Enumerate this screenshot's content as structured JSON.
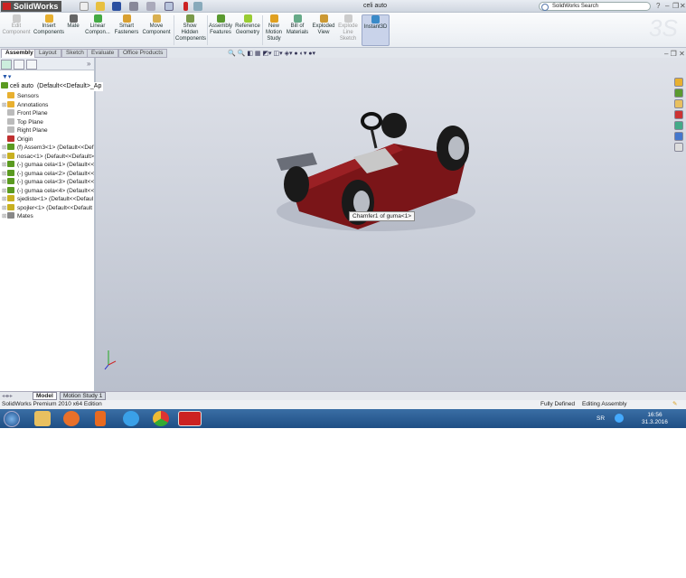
{
  "app": {
    "logo": "SolidWorks",
    "doc_title": "celi auto",
    "search_placeholder": "SolidWorks Search",
    "help": "?",
    "win_min": "–",
    "win_restore": "❐",
    "win_close": "✕"
  },
  "ribbon": [
    {
      "label": "Edit Component",
      "disabled": true
    },
    {
      "label": "Insert Components"
    },
    {
      "label": "Mate"
    },
    {
      "label": "Linear Compon..."
    },
    {
      "label": "Smart Fasteners"
    },
    {
      "label": "Move Component"
    },
    {
      "label": "Show Hidden Components"
    },
    {
      "label": "Assembly Features"
    },
    {
      "label": "Reference Geometry"
    },
    {
      "label": "New Motion Study"
    },
    {
      "label": "Bill of Materials"
    },
    {
      "label": "Exploded View"
    },
    {
      "label": "Explode Line Sketch",
      "disabled": true
    },
    {
      "label": "Instant3D",
      "active": true
    }
  ],
  "tabs": [
    "Assembly",
    "Layout",
    "Sketch",
    "Evaluate",
    "Office Products"
  ],
  "tree": {
    "root": "celi auto  (Default<<Default>_Ap",
    "items": [
      {
        "label": "Sensors",
        "exp": false,
        "color": "#e8b030"
      },
      {
        "label": "Annotations",
        "exp": true,
        "color": "#e8b030"
      },
      {
        "label": "Front Plane",
        "exp": false,
        "color": "#bbbbbb"
      },
      {
        "label": "Top Plane",
        "exp": false,
        "color": "#bbbbbb"
      },
      {
        "label": "Right Plane",
        "exp": false,
        "color": "#bbbbbb"
      },
      {
        "label": "Origin",
        "exp": false,
        "color": "#c03030"
      },
      {
        "label": "(f) Assem3<1> (Default<<Def",
        "exp": true,
        "color": "#5a9a20"
      },
      {
        "label": "nosac<1> (Default<<Default>",
        "exp": true,
        "color": "#c8b020"
      },
      {
        "label": "(-) gumaa cela<1> (Default<<",
        "exp": true,
        "color": "#5a9a20"
      },
      {
        "label": "(-) gumaa cela<2> (Default<<",
        "exp": true,
        "color": "#5a9a20"
      },
      {
        "label": "(-) gumaa cela<3> (Default<<",
        "exp": true,
        "color": "#5a9a20"
      },
      {
        "label": "(-) gumaa cela<4> (Default<<",
        "exp": true,
        "color": "#5a9a20"
      },
      {
        "label": "sjediste<1> (Default<<Defaul",
        "exp": true,
        "color": "#c8b020"
      },
      {
        "label": "spojler<1> (Default<<Default",
        "exp": true,
        "color": "#c8b020"
      },
      {
        "label": "Mates",
        "exp": true,
        "color": "#888888"
      }
    ]
  },
  "viewport": {
    "tooltip": "Chamfer1 of guma<1>"
  },
  "bottom_tabs": [
    "Model",
    "Motion Study 1"
  ],
  "status": {
    "edition": "SolidWorks Premium 2010 x64 Edition",
    "state": "Fully Defined",
    "mode": "Editing Assembly"
  },
  "taskbar": {
    "lang": "SR",
    "time": "16:56",
    "date": "31.3.2016"
  },
  "colors": {
    "car_body": "#7a1518",
    "viewport_top": "#dfe2e9",
    "taskbar": "#2a5a92"
  }
}
